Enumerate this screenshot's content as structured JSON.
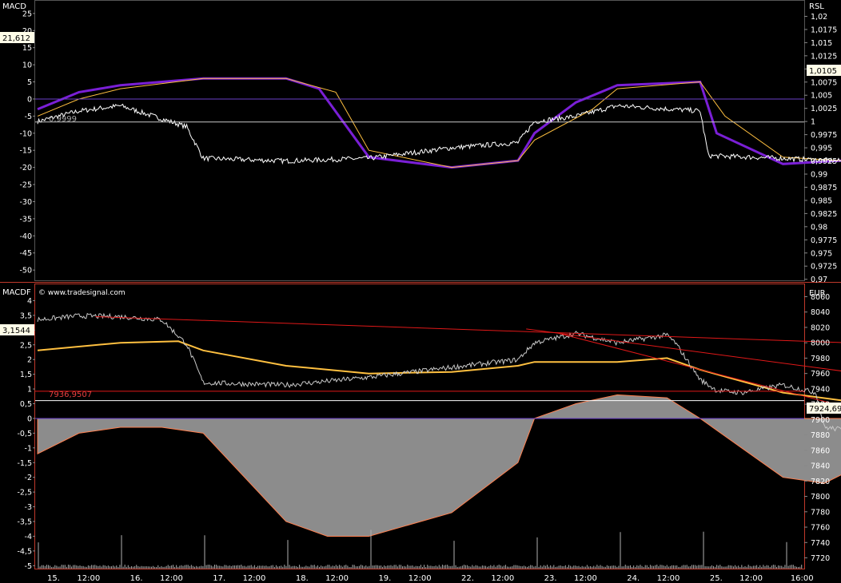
{
  "top_panel": {
    "left_label": "MACD",
    "right_label": "RSL",
    "current_left": "21,612",
    "current_right": "1,0105",
    "ref_label": "0,9999"
  },
  "bottom_panel": {
    "left_label": "MACDF",
    "right_label": "EUR",
    "watermark": "© www.tradesignal.com",
    "current_left": "3,1544",
    "current_right": "7924,69",
    "hline_label": "7936,9507"
  },
  "time_axis": [
    "15.",
    "12:00",
    "16.",
    "12:00",
    "17.",
    "12:00",
    "18.",
    "12:00",
    "19.",
    "12:00",
    "22.",
    "12:00",
    "23.",
    "12:00",
    "24.",
    "12:00",
    "25.",
    "12:00",
    "16:00"
  ],
  "colors": {
    "background": "#000000",
    "price": "#ffffff",
    "macd": "#7a1fd6",
    "signal": "#ffc040",
    "hist_fill": "#8c8c8c",
    "hist_edge": "#ff8050",
    "trendline": "#e01818",
    "zero_line": "#6a40c8",
    "axis_text": "#ffffff",
    "border": "#c0392b"
  },
  "chart_data": [
    {
      "type": "line",
      "left_axis": {
        "label": "MACD",
        "ylim": [
          -53,
          28
        ],
        "ticks": [
          25,
          20,
          15,
          10,
          5,
          0,
          -5,
          -10,
          -15,
          -20,
          -25,
          -30,
          -35,
          -40,
          -45,
          -50
        ]
      },
      "right_axis": {
        "label": "RSL",
        "ylim": [
          0.9698,
          1.0225
        ],
        "ticks": [
          "1,02",
          "1,0175",
          "1,015",
          "1,0125",
          "1,01",
          "1,0075",
          "1,005",
          "1,0025",
          "1",
          "0,9975",
          "0,995",
          "0,9925",
          "0,99",
          "0,9875",
          "0,985",
          "0,9825",
          "0,98",
          "0,9775",
          "0,975",
          "0,9725",
          "0,97"
        ]
      },
      "hlines": [
        {
          "axis": "left",
          "value": 0
        },
        {
          "axis": "right",
          "value": 0.9999,
          "label": "0,9999"
        }
      ],
      "series": [
        {
          "axis": "left",
          "style": "macd",
          "x": [
            0,
            0.5,
            1,
            2,
            3,
            3.4,
            4,
            5,
            5.8,
            6,
            6.5,
            7,
            8,
            8.2,
            9,
            9.7,
            10,
            10.5,
            11,
            11.6,
            12,
            13,
            13.6,
            14,
            15,
            15.4,
            16,
            17,
            18,
            18.6,
            19,
            19.4
          ],
          "values": [
            -3,
            2,
            4,
            6,
            6,
            3,
            -17,
            -20,
            -18,
            -10,
            -1,
            4,
            5,
            -10,
            -19,
            -18,
            -20,
            -30,
            -45,
            -45,
            -38,
            -15,
            -5,
            -7,
            -7,
            -6,
            -5,
            -3,
            20,
            25,
            25,
            24
          ]
        },
        {
          "axis": "left",
          "style": "signal",
          "x": [
            0,
            0.5,
            1,
            2,
            3,
            3.6,
            4,
            5,
            5.8,
            6,
            6.7,
            7,
            8,
            8.3,
            9,
            9.7,
            10,
            10.6,
            11,
            11.6,
            12,
            13,
            13.8,
            14,
            15,
            15.5,
            16,
            17,
            18,
            18.6,
            19,
            19.4
          ],
          "values": [
            -5,
            0,
            3,
            6,
            6,
            2,
            -15,
            -20,
            -18,
            -12,
            -3,
            3,
            5,
            -5,
            -17,
            -18,
            -20,
            -30,
            -43,
            -45,
            -40,
            -18,
            -7,
            -7,
            -7,
            -6,
            -5,
            -3,
            17,
            22,
            25,
            24
          ]
        },
        {
          "axis": "right",
          "style": "price",
          "x": [
            0,
            0.5,
            1,
            1.8,
            2,
            3,
            4,
            5,
            5.8,
            6,
            6.5,
            7,
            8,
            8.1,
            9,
            9.7,
            10,
            10.05,
            10.6,
            11,
            11.6,
            12,
            13,
            13.8,
            14,
            15,
            15.5,
            16,
            17,
            17.6,
            18,
            18.6,
            19,
            19.4
          ],
          "values": [
            1.0,
            1.002,
            1.003,
            0.999,
            0.993,
            0.9925,
            0.993,
            0.995,
            0.996,
            1.0,
            1.001,
            1.003,
            1.002,
            0.9935,
            0.993,
            0.9925,
            0.9925,
            0.9785,
            0.9795,
            0.982,
            0.985,
            0.9875,
            0.9925,
            0.996,
            0.9985,
            0.9975,
            0.9985,
            0.999,
            1.001,
            1.006,
            1.01,
            1.0175,
            1.012,
            1.0105
          ]
        }
      ]
    },
    {
      "type": "line",
      "left_axis": {
        "label": "MACDF",
        "ylim": [
          -5.1,
          4.5
        ],
        "ticks": [
          "4",
          "3,5",
          "3",
          "2,5",
          "2",
          "1,5",
          "1",
          "0,5",
          "0",
          "-0,5",
          "-1",
          "-1,5",
          "-2",
          "-2,5",
          "-3",
          "-3,5",
          "-4",
          "-4,5",
          "-5"
        ]
      },
      "right_axis": {
        "label": "EUR",
        "ylim": [
          7706,
          8074
        ],
        "ticks": [
          8060,
          8040,
          8020,
          8000,
          7980,
          7960,
          7940,
          7920,
          7900,
          7880,
          7860,
          7840,
          7820,
          7800,
          7780,
          7760,
          7740,
          7720
        ]
      },
      "hlines": [
        {
          "axis": "left",
          "value": 0
        },
        {
          "axis": "right",
          "value": 7936.9507,
          "label": "7936,9507"
        },
        {
          "axis": "right",
          "value": 7924.69
        }
      ],
      "series": [
        {
          "axis": "left",
          "style": "histogram",
          "x": [
            0,
            0.5,
            1,
            1.5,
            2,
            3,
            3.5,
            4,
            5,
            5.8,
            6,
            6.5,
            7,
            7.6,
            8,
            8.5,
            9,
            9.5,
            10,
            10.5,
            11,
            11.5,
            12,
            12.5,
            13,
            13.5,
            14,
            14.5,
            15,
            15.5,
            16,
            16.5,
            17,
            17.5,
            18,
            18.5,
            19,
            19.4
          ],
          "values": [
            -1.2,
            -0.5,
            -0.3,
            -0.3,
            -0.5,
            -3.5,
            -4,
            -4,
            -3.2,
            -1.5,
            0,
            0.5,
            0.8,
            0.7,
            0,
            -1,
            -2,
            -2.2,
            -1.5,
            -2,
            -3.8,
            -4.3,
            -3.8,
            -2.2,
            0,
            0.9,
            1.2,
            1.1,
            0.8,
            0.8,
            0.8,
            1,
            1.2,
            1.5,
            3,
            3.7,
            4,
            3.15
          ]
        },
        {
          "axis": "right",
          "style": "signal",
          "x": [
            0,
            1,
            1.7,
            2,
            3,
            4,
            5,
            5.8,
            6,
            7,
            7.6,
            8,
            9,
            9.7,
            10,
            11,
            12,
            12.5,
            13,
            14,
            15,
            16,
            16.6,
            17,
            18,
            19,
            19.4
          ],
          "values": [
            7990,
            8000,
            8002,
            7990,
            7970,
            7960,
            7962,
            7970,
            7975,
            7975,
            7980,
            7965,
            7935,
            7925,
            7910,
            7870,
            7835,
            7825,
            7830,
            7828,
            7827,
            7826,
            7830,
            7832,
            7845,
            7873,
            7880
          ]
        },
        {
          "axis": "right",
          "style": "price",
          "x": [
            0,
            0.5,
            1,
            1.5,
            1.8,
            2,
            3,
            4,
            5,
            5.8,
            6,
            6.5,
            7,
            7.6,
            7.7,
            8,
            8.2,
            8.5,
            9,
            9.4,
            9.5,
            10,
            10.05,
            10.6,
            11,
            11.6,
            12,
            12.6,
            13,
            13.6,
            14,
            14.2,
            14.6,
            15,
            15.5,
            16,
            16.2,
            16.5,
            17,
            17.2,
            17.6,
            18,
            18.3,
            18.6,
            19,
            19.4
          ],
          "values": [
            8030,
            8035,
            8034,
            8030,
            7998,
            7948,
            7945,
            7955,
            7968,
            7978,
            8000,
            8012,
            8000,
            8010,
            8000,
            7952,
            7938,
            7935,
            7945,
            7935,
            7890,
            7883,
            7775,
            7785,
            7800,
            7792,
            7810,
            7830,
            7846,
            7865,
            7840,
            7830,
            7810,
            7818,
            7830,
            7845,
            7830,
            7815,
            7895,
            7900,
            7920,
            7960,
            7940,
            7935,
            7915,
            7925
          ]
        },
        {
          "axis": "right",
          "style": "trend",
          "x": [
            0.7,
            19.4
          ],
          "values": [
            8034,
            7964
          ]
        },
        {
          "axis": "right",
          "style": "trend",
          "x": [
            5.9,
            19.4
          ],
          "values": [
            8018,
            7824
          ]
        },
        {
          "axis": "right",
          "style": "trend",
          "x": [
            6.3,
            14.2
          ],
          "values": [
            8012,
            7794
          ]
        }
      ]
    }
  ]
}
